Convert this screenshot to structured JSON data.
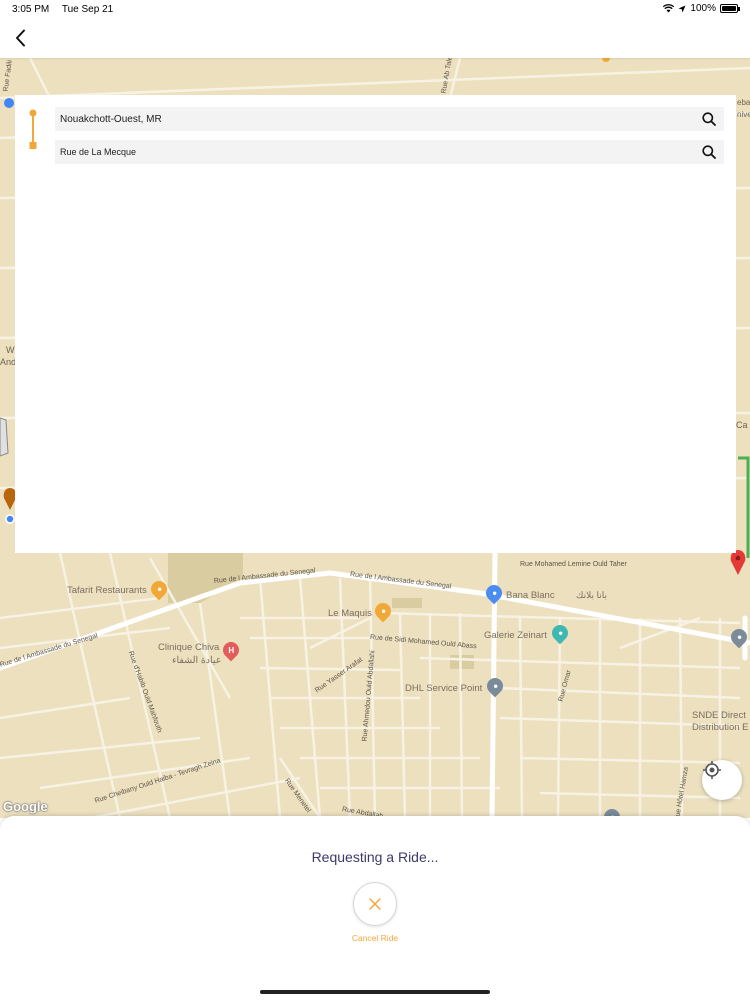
{
  "status_bar": {
    "time": "3:05 PM",
    "date": "Tue Sep 21",
    "battery": "100%",
    "battery_level": 1.0
  },
  "nav": {
    "back_icon": "chevron-left-icon"
  },
  "search": {
    "pickup_value": "Nouakchott-Ouest, MR",
    "dropoff_value": "Rue de La Mecque",
    "search_icon": "search-icon"
  },
  "map": {
    "streets": {
      "ambassade_1": "Rue de l Ambassade du Senegal",
      "ambassade_2": "Rue de l Ambassade du Senegal",
      "ambassade_3": "Rue de l Ambassade du Senegal",
      "mohamed_lemine": "Rue Mohamed Lemine Ould Taher",
      "sidi_mohamed": "Rue de Sidi Mohamed Ould Abass",
      "habib": "Rue d'Habib Ould Mahfouth",
      "yasser": "Rue Yasser Arafat",
      "ahmedou": "Rue Ahmedou Ould Abdallahi",
      "cheibany": "Rue Cheibany Ould Haiba - Tevragh Zeina",
      "omar": "Rue Omar",
      "menetel": "Rue Menetel",
      "hamza": "Rue Hôtel Hamza",
      "abdallah": "Rue Abdallah",
      "ab_taleb": "Rue Ab Taleb",
      "fadili": "Rue Fadili B"
    },
    "pois": {
      "tafarit": "Tafarit Restaurants",
      "maquis": "Le Maquis",
      "clinique": "Clinique Chiva",
      "clinique_ar": "عيادة الشفاء",
      "bana_blanc": "Bana Blanc",
      "bana_blanc_ar": "بانا بلانك",
      "galerie": "Galerie Zeinart",
      "dhl": "DHL Service Point",
      "snde_1": "SNDE Direct",
      "snde_2": "Distribution E"
    },
    "edge_labels": {
      "left_w": "W",
      "left_and": "And",
      "right_ca": "Ca",
      "right_eba": "eba",
      "right_univ": "nive"
    },
    "google_logo": "Google",
    "colors": {
      "land": "#ece0bf",
      "road": "#ffffff",
      "park": "#d9cca0",
      "route": "#4caf50",
      "destination_pin": "#e53935"
    }
  },
  "locate_icon": "crosshair-icon",
  "ride": {
    "status_title": "Requesting a Ride...",
    "cancel_label": "Cancel Ride",
    "cancel_icon": "close-icon",
    "accent": "#f2a838"
  }
}
